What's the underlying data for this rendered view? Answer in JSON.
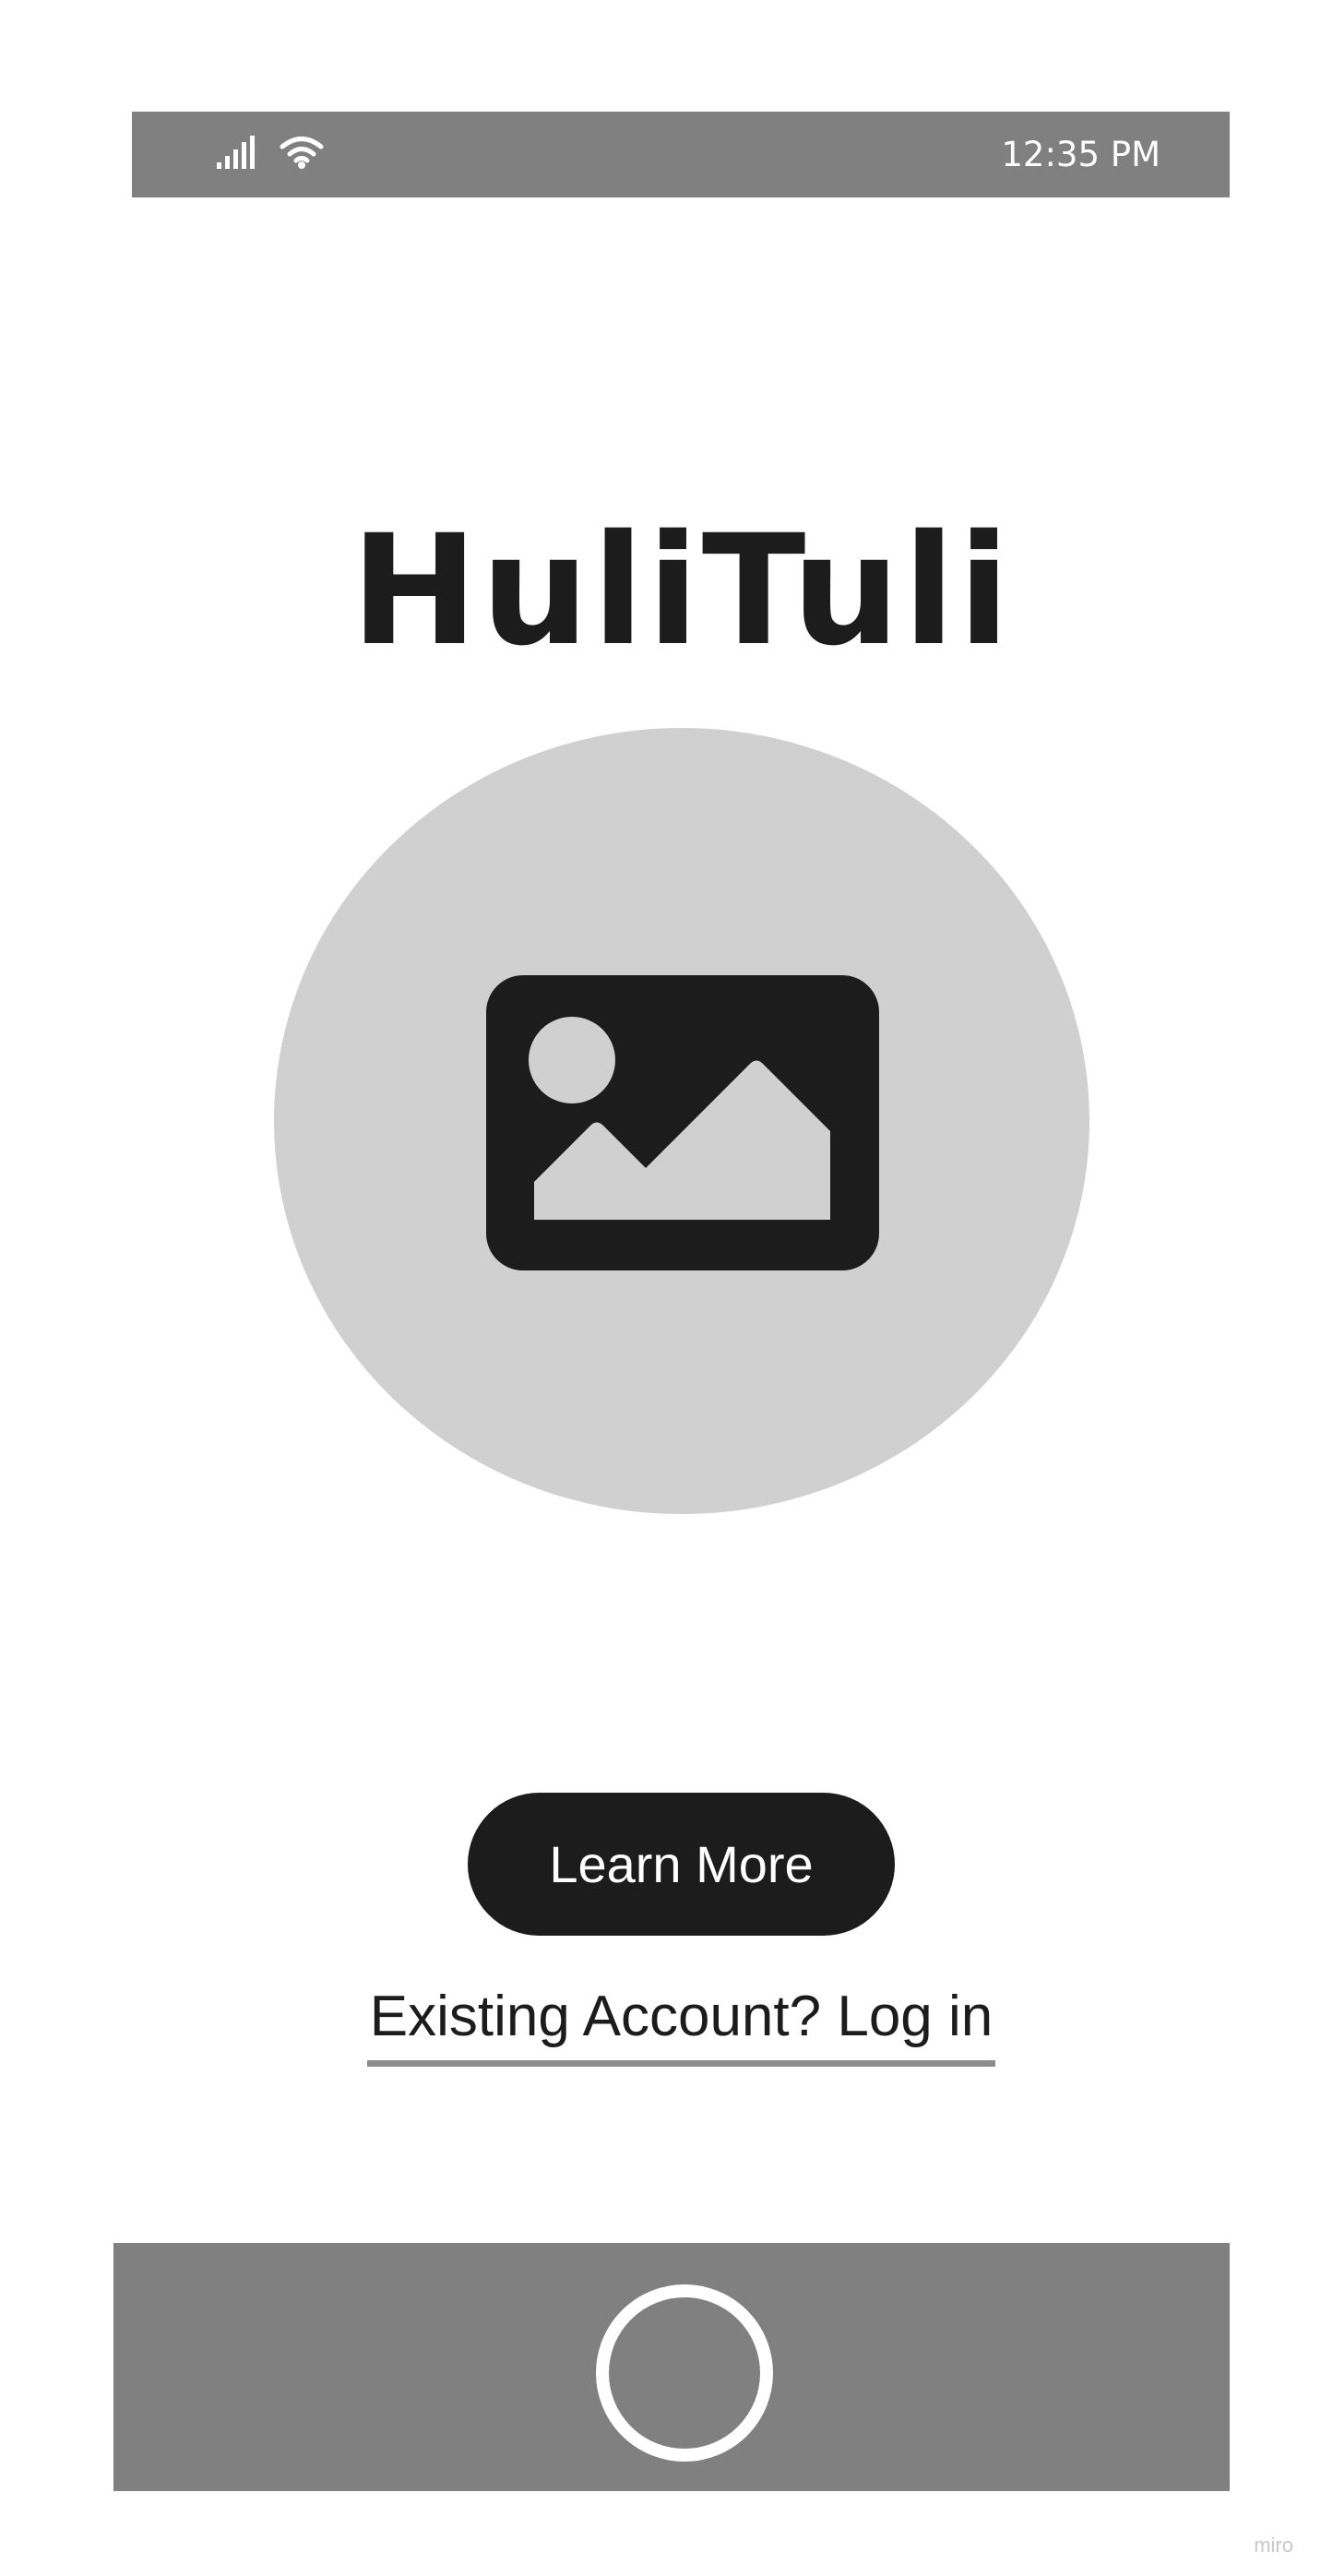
{
  "status_bar": {
    "time": "12:35 PM",
    "icons": [
      "signal-icon",
      "wifi-icon"
    ]
  },
  "app": {
    "title": "HuliTuli"
  },
  "hero": {
    "icon": "image-placeholder-icon"
  },
  "actions": {
    "learn_more_label": "Learn More",
    "login_label": "Existing Account? Log in"
  },
  "nav_bar": {
    "icon": "home-button-icon"
  },
  "watermark": "miro",
  "colors": {
    "bar_gray": "#808080",
    "circle_gray": "#d0d0d0",
    "dark": "#1c1c1c",
    "underline_gray": "#8c8c8c",
    "background": "#ffffff"
  }
}
